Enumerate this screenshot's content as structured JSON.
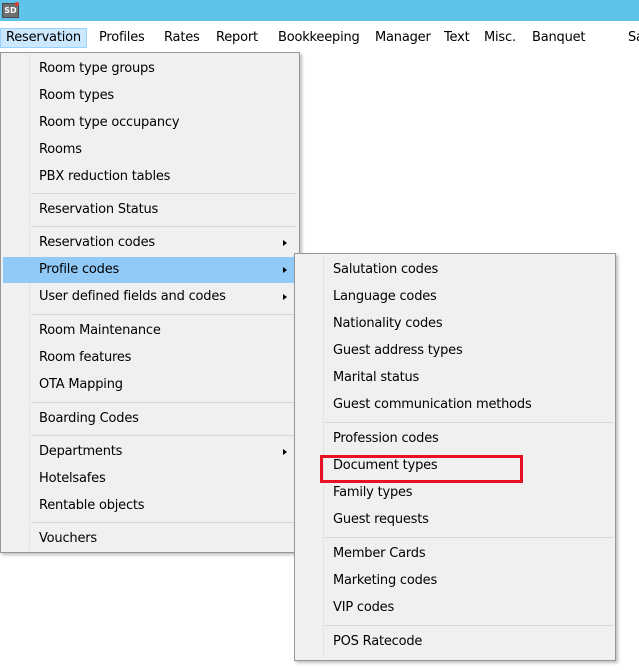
{
  "app": {
    "icon_text": "SD",
    "icon": "app-icon"
  },
  "menubar": {
    "items": [
      "Reservation",
      "Profiles",
      "Rates",
      "Report",
      "Bookkeeping",
      "Manager",
      "Text",
      "Misc.",
      "Banquet",
      "Sa"
    ]
  },
  "reservation_menu": {
    "items": [
      "Room type groups",
      "Room types",
      "Room type occupancy",
      "Rooms",
      "PBX reduction tables",
      "Reservation Status",
      "Reservation codes",
      "Profile codes",
      "User defined fields and codes",
      "Room  Maintenance",
      "Room features",
      "OTA Mapping",
      "Boarding Codes",
      "Departments",
      "Hotelsafes",
      "Rentable objects",
      "Vouchers"
    ],
    "highlighted": "Profile codes"
  },
  "profile_codes_menu": {
    "items": [
      "Salutation codes",
      "Language codes",
      "Nationality codes",
      "Guest address types",
      "Marital status",
      "Guest communication methods",
      "Profession codes",
      "Document types",
      "Family types",
      "Guest requests",
      "Member Cards",
      "Marketing codes",
      "VIP codes",
      "POS Ratecode"
    ],
    "annotated": "Document types"
  },
  "colors": {
    "titlebar": "#5fc3ea",
    "menu_bg": "#f0f0f0",
    "highlight": "#91c9f7",
    "annotation": "#e81123"
  }
}
